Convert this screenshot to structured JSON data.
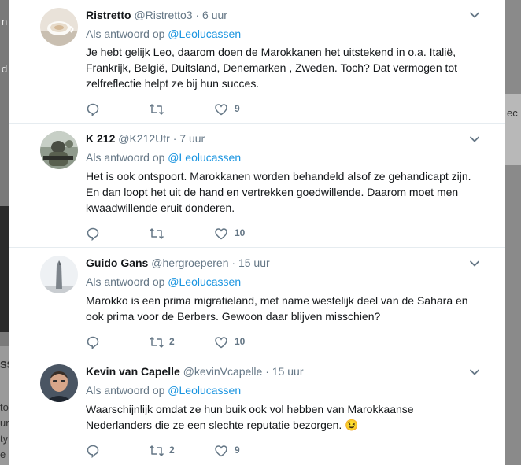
{
  "background": {
    "left_fragments": [
      "n",
      "d",
      "SS",
      "to",
      "ur",
      "ty",
      "e"
    ],
    "right_fragments": [
      "ec"
    ]
  },
  "tweets": [
    {
      "name": "Ristretto",
      "handle": "@Ristretto3",
      "time": "6 uur",
      "reply_prefix": "Als antwoord op",
      "reply_to": "@Leolucassen",
      "text": "Je hebt gelijk Leo, daarom doen de Marokkanen het uitstekend in o.a. Italië, Frankrijk, België, Duitsland, Denemarken , Zweden. Toch? Dat vermogen tot zelfreflectie helpt ze bij hun succes.",
      "replies": "",
      "retweets": "",
      "likes": "9",
      "avatar": "coffee-cup"
    },
    {
      "name": "K 212",
      "handle": "@K212Utr",
      "time": "7 uur",
      "reply_prefix": "Als antwoord op",
      "reply_to": "@Leolucassen",
      "text": "Het is ook ontspoort. Marokkanen worden behandeld alsof ze gehandicapt zijn. En dan loopt het uit de hand en vertrekken goedwillende. Daarom moet men kwaadwillende eruit donderen.",
      "replies": "",
      "retweets": "",
      "likes": "10",
      "avatar": "soldier"
    },
    {
      "name": "Guido Gans",
      "handle": "@hergroeperen",
      "time": "15 uur",
      "reply_prefix": "Als antwoord op",
      "reply_to": "@Leolucassen",
      "text": "Marokko is een prima migratieland, met name westelijk deel van de Sahara en ook prima voor de Berbers. Gewoon daar blijven misschien?",
      "replies": "",
      "retweets": "2",
      "likes": "10",
      "avatar": "obelisk"
    },
    {
      "name": "Kevin van Capelle",
      "handle": "@kevinVcapelle",
      "time": "15 uur",
      "reply_prefix": "Als antwoord op",
      "reply_to": "@Leolucassen",
      "text": "Waarschijnlijk omdat ze hun buik ook vol hebben van Marokkaanse Nederlanders die ze een slechte reputatie bezorgen. 😉",
      "replies": "",
      "retweets": "2",
      "likes": "9",
      "avatar": "man-portrait"
    }
  ],
  "colors": {
    "link": "#1b95e0",
    "muted": "#657786",
    "text": "#14171a",
    "divider": "#e6ecf0"
  },
  "icons": [
    "reply-icon",
    "retweet-icon",
    "like-icon",
    "chevron-down-icon"
  ]
}
